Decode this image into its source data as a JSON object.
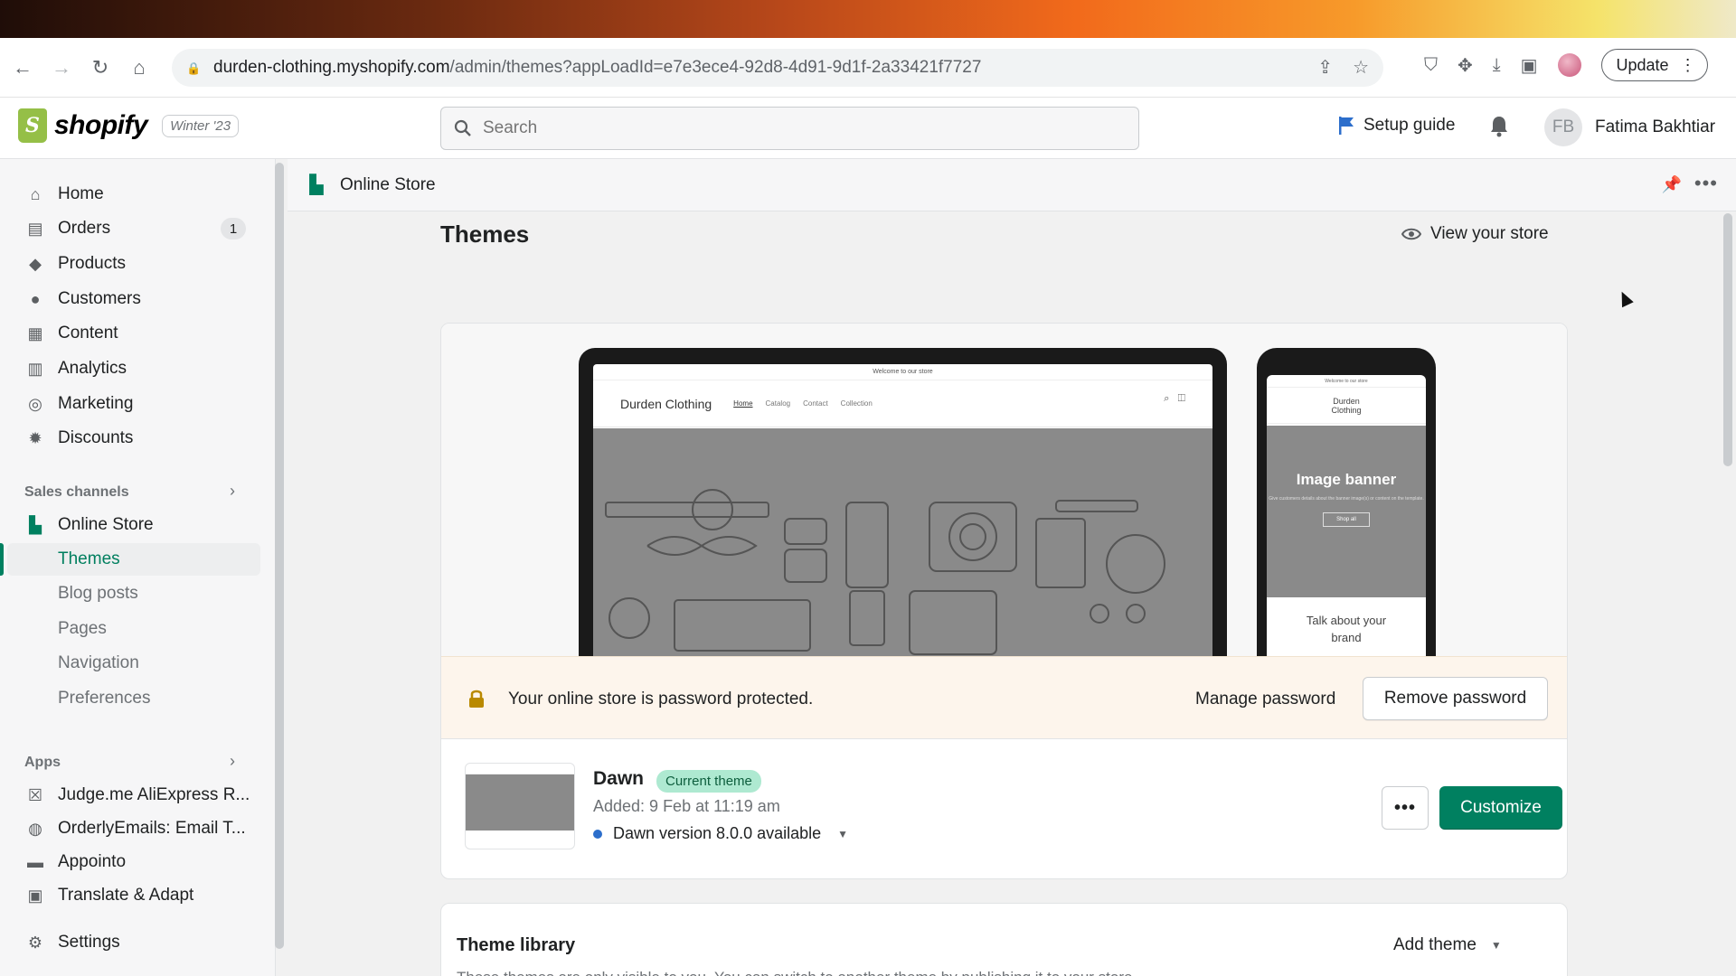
{
  "browser": {
    "url_host": "durden-clothing.myshopify.com",
    "url_path": "/admin/themes?appLoadId=e7e3ece4-92d8-4d91-9d1f-2a33421f7727",
    "update_label": "Update"
  },
  "topbar": {
    "logo_text": "shopify",
    "release_badge": "Winter '23",
    "search_placeholder": "Search",
    "setup_guide": "Setup guide",
    "user_initials": "FB",
    "user_name": "Fatima Bakhtiar"
  },
  "sidebar": {
    "items": [
      {
        "label": "Home",
        "icon": "home-icon"
      },
      {
        "label": "Orders",
        "icon": "orders-icon",
        "badge": "1"
      },
      {
        "label": "Products",
        "icon": "tag-icon"
      },
      {
        "label": "Customers",
        "icon": "person-icon"
      },
      {
        "label": "Content",
        "icon": "content-icon"
      },
      {
        "label": "Analytics",
        "icon": "bar-chart-icon"
      },
      {
        "label": "Marketing",
        "icon": "marketing-icon"
      },
      {
        "label": "Discounts",
        "icon": "discount-icon"
      }
    ],
    "sales_channels_label": "Sales channels",
    "online_store": "Online Store",
    "online_store_sub": [
      "Themes",
      "Blog posts",
      "Pages",
      "Navigation",
      "Preferences"
    ],
    "apps_label": "Apps",
    "apps": [
      "Judge.me AliExpress R...",
      "OrderlyEmails: Email T...",
      "Appointo",
      "Translate & Adapt"
    ],
    "settings": "Settings"
  },
  "main": {
    "breadcrumb": "Online Store",
    "page_title": "Themes",
    "view_store": "View your store",
    "preview": {
      "laptop_announcement": "Welcome to our store",
      "store_name": "Durden Clothing",
      "nav": [
        "Home",
        "Catalog",
        "Contact",
        "Collection"
      ],
      "phone_announcement": "Welcome to our store",
      "phone_store_name": "Durden Clothing",
      "phone_banner_title": "Image banner",
      "phone_banner_sub": "Give customers details about the banner image(s) or content on the template.",
      "phone_shop_btn": "Shop all",
      "phone_text": "Talk about your brand"
    },
    "password_banner": {
      "text": "Your online store is password protected.",
      "manage": "Manage password",
      "remove": "Remove password"
    },
    "current_theme": {
      "name": "Dawn",
      "badge": "Current theme",
      "added": "Added: 9 Feb at 11:19 am",
      "version": "Dawn version 8.0.0 available",
      "customize": "Customize"
    },
    "library": {
      "title": "Theme library",
      "add_theme": "Add theme",
      "note": "These themes are only visible to you. You can switch to another theme by publishing it to your store."
    }
  },
  "colors": {
    "brand_green": "#008060",
    "badge_green": "#aee9d1",
    "warning_bg": "#fdf5ec"
  }
}
